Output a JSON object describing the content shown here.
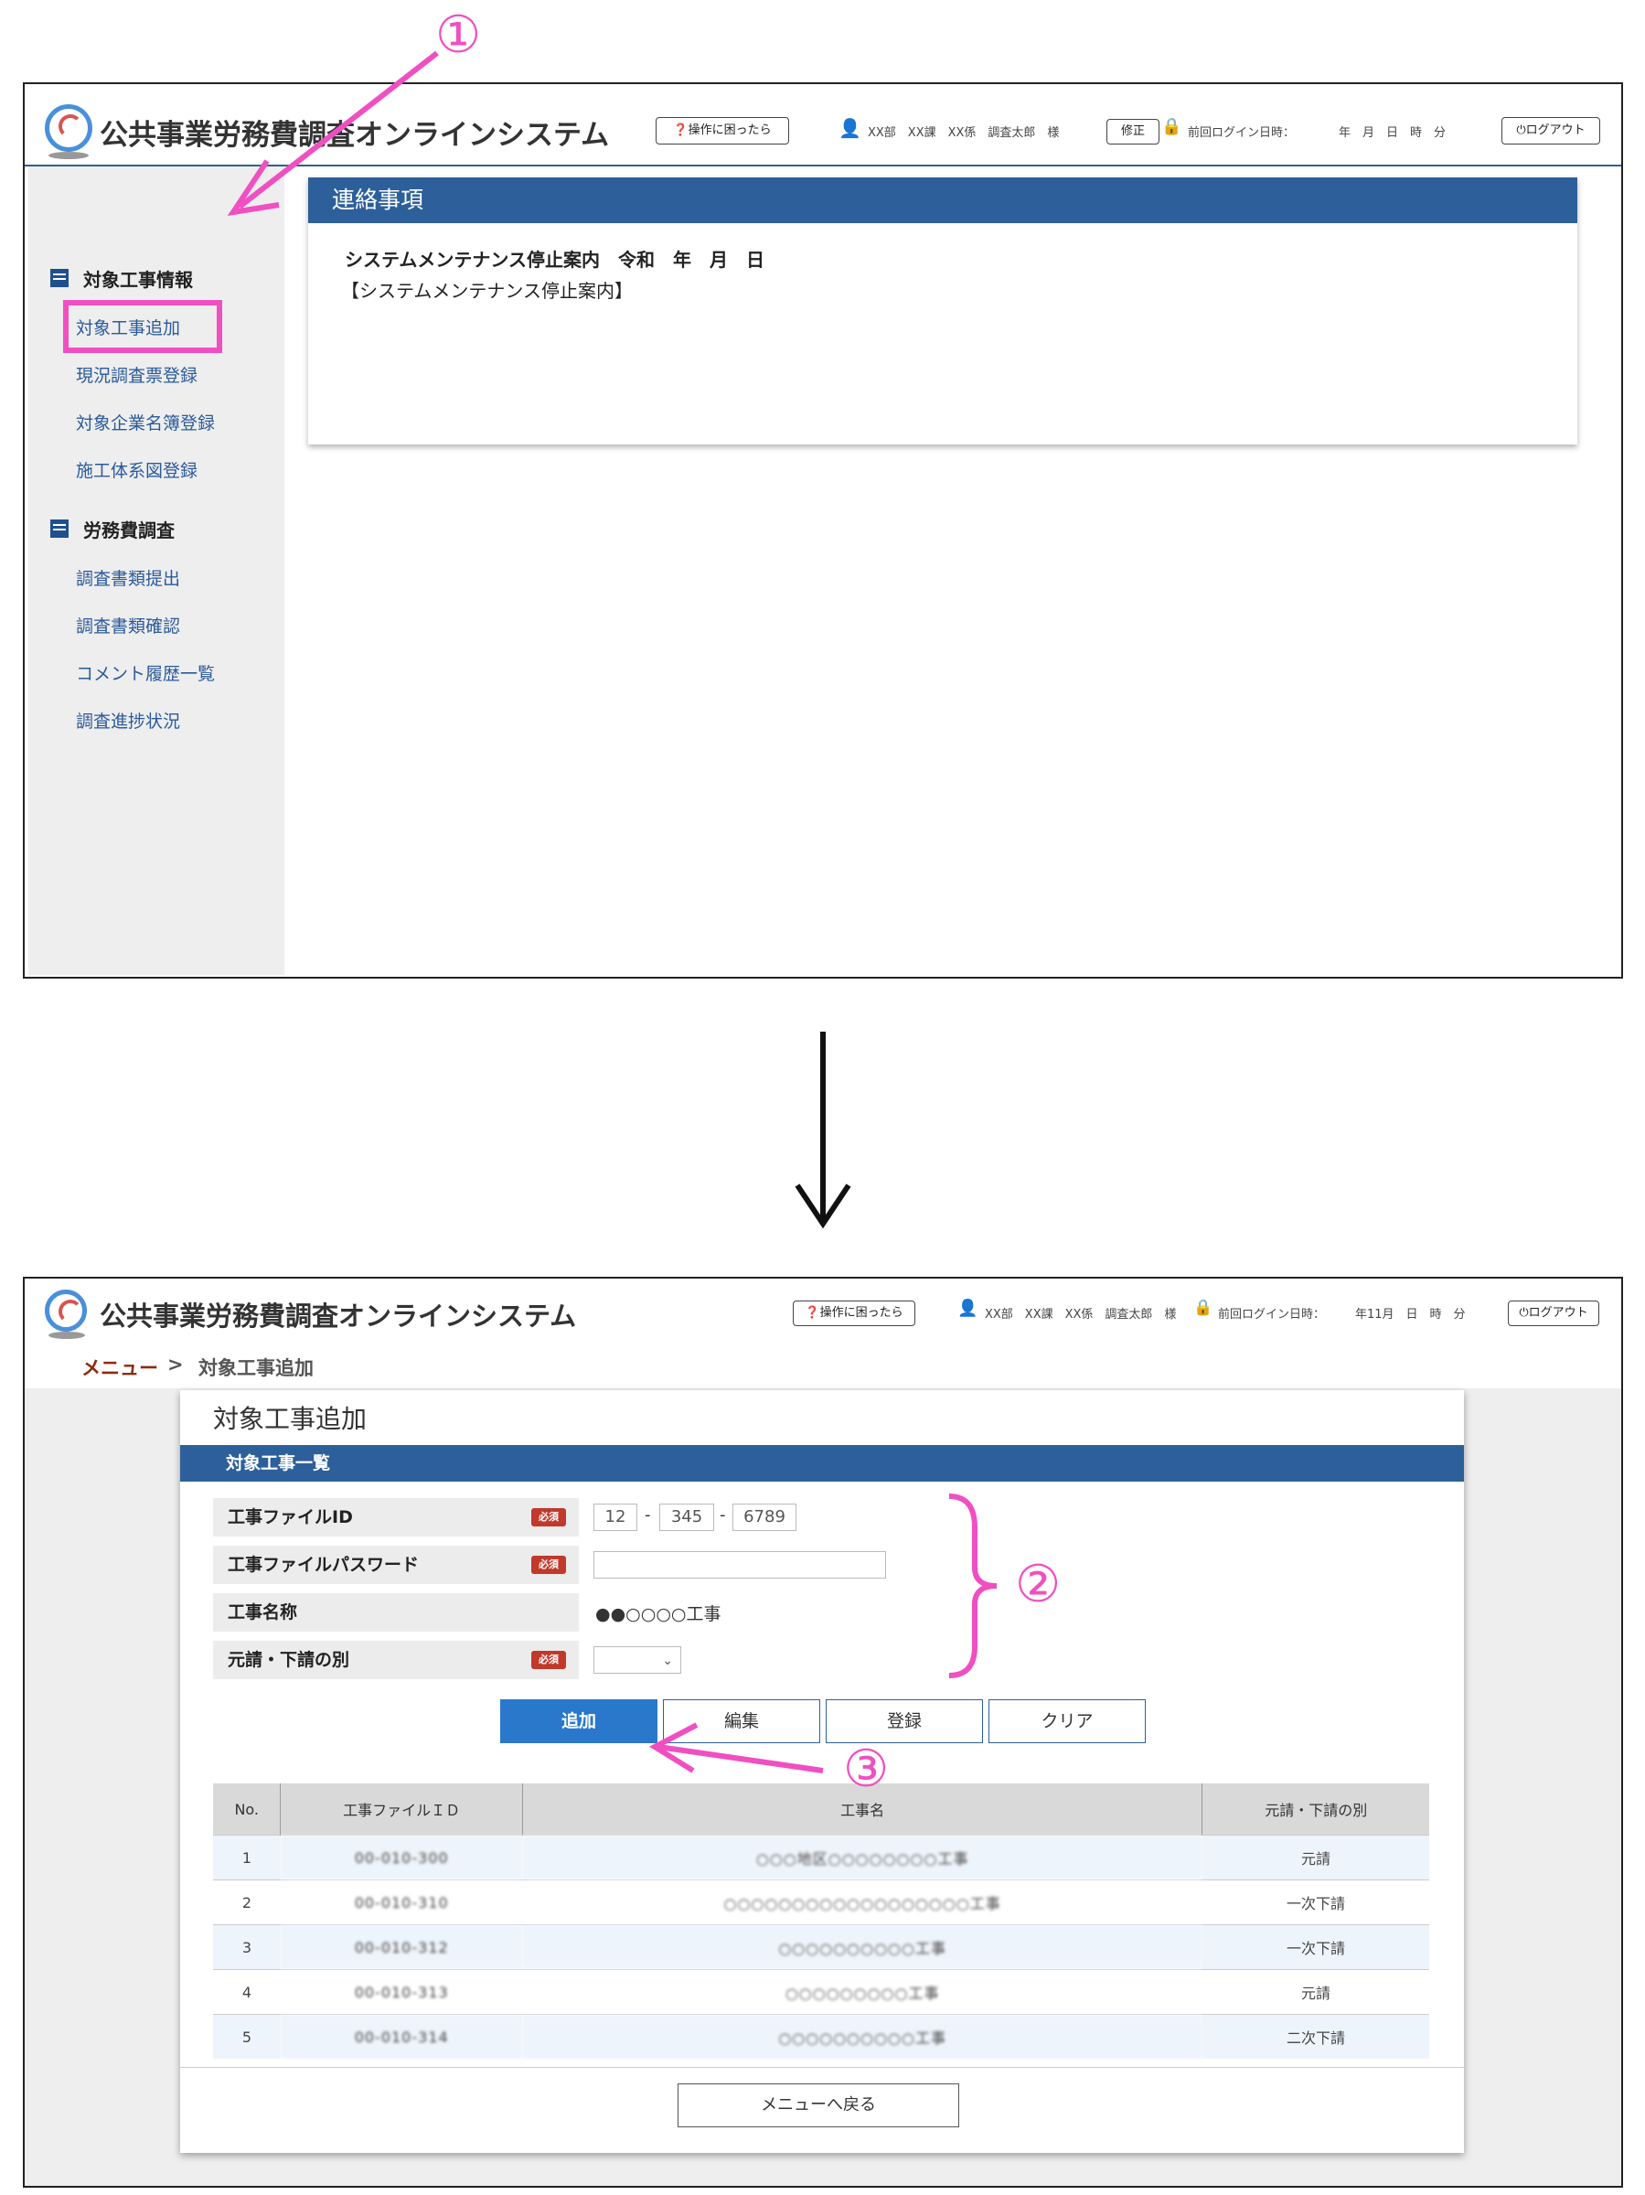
{
  "app": {
    "title": "公共事業労務費調査オンラインシステム",
    "help_button": "操作に困ったら",
    "user_info": "XX部　XX課　XX係　調査太郎　様",
    "edit_button": "修正",
    "last_login_label": "前回ログイン日時：",
    "last_login_value_top": "年　月　日　時　分",
    "last_login_value_bottom": "年11月　日　時　分",
    "logout_button": "ログアウト"
  },
  "sidebar": {
    "section1": {
      "title": "対象工事情報",
      "items": [
        "対象工事追加",
        "現況調査票登録",
        "対象企業名簿登録",
        "施工体系図登録"
      ]
    },
    "section2": {
      "title": "労務費調査",
      "items": [
        "調査書類提出",
        "調査書類確認",
        "コメント履歴一覧",
        "調査進捗状況"
      ]
    }
  },
  "notice": {
    "header": "連絡事項",
    "headline": "システムメンテナンス停止案内　令和　年　月　日",
    "body": "【システムメンテナンス停止案内】"
  },
  "annotations": {
    "step1": "①",
    "step2": "②",
    "step3": "③"
  },
  "breadcrumb": {
    "menu": "メニュー",
    "separator": ">",
    "current": "対象工事追加"
  },
  "form": {
    "title": "対象工事追加",
    "section": "対象工事一覧",
    "required_badge": "必須",
    "fields": {
      "file_id_label": "工事ファイルID",
      "file_id_1": "12",
      "file_id_2": "345",
      "file_id_3": "6789",
      "dash": "-",
      "password_label": "工事ファイルパスワード",
      "password_value": "",
      "name_label": "工事名称",
      "name_value": "●●○○○○工事",
      "contract_label": "元請・下請の別",
      "contract_value": ""
    },
    "buttons": {
      "add": "追加",
      "edit": "編集",
      "register": "登録",
      "clear": "クリア"
    },
    "back_button": "メニューへ戻る"
  },
  "table": {
    "headers": [
      "No.",
      "工事ファイルＩＤ",
      "工事名",
      "元請・下請の別"
    ],
    "rows": [
      [
        "1",
        "00-010-300",
        "○○○地区○○○○○○○○工事",
        "元請"
      ],
      [
        "2",
        "00-010-310",
        "○○○○○○○○○○○○○○○○○○工事",
        "一次下請"
      ],
      [
        "3",
        "00-010-312",
        "○○○○○○○○○○工事",
        "一次下請"
      ],
      [
        "4",
        "00-010-313",
        "○○○○○○○○○工事",
        "元請"
      ],
      [
        "5",
        "00-010-314",
        "○○○○○○○○○○工事",
        "二次下請"
      ]
    ]
  }
}
